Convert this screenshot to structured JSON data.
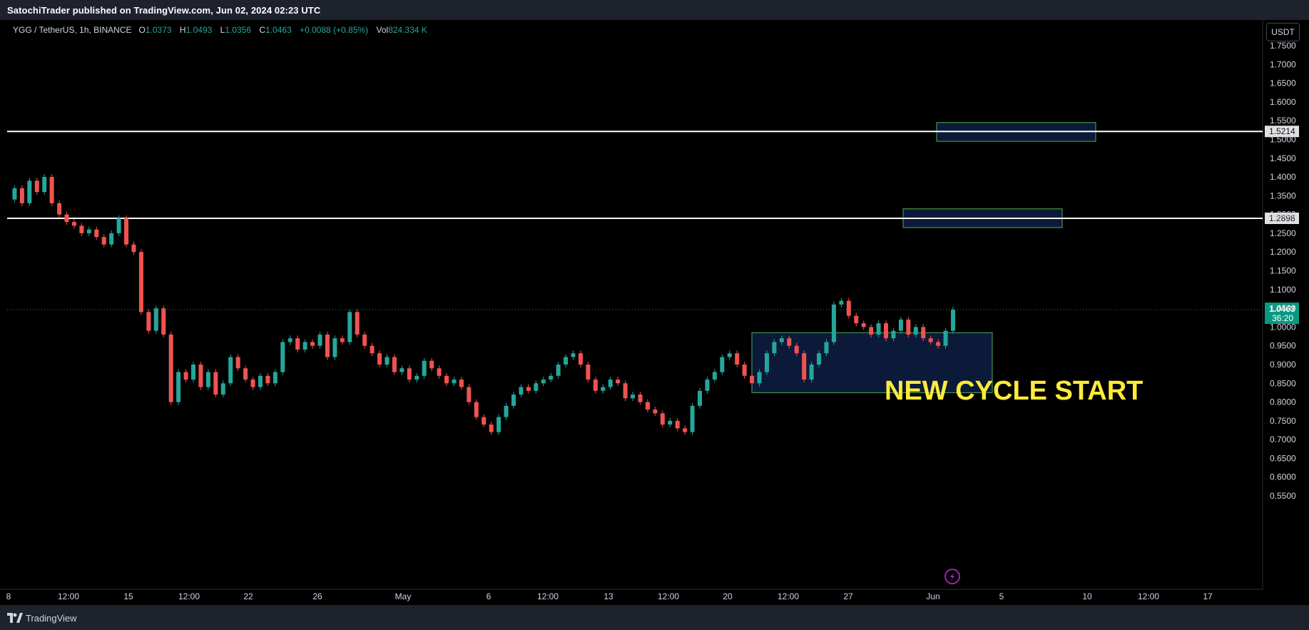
{
  "header": {
    "published": "SatochiTrader published on TradingView.com, Jun 02, 2024 02:23 UTC"
  },
  "footer": {
    "brand": "TradingView"
  },
  "legend": {
    "symbol": "YGG / TetherUS, 1h, BINANCE",
    "o_label": "O",
    "o_value": "1.0373",
    "h_label": "H",
    "h_value": "1.0493",
    "l_label": "L",
    "l_value": "1.0356",
    "c_label": "C",
    "c_value": "1.0463",
    "change": "+0.0088 (+0.85%)",
    "vol_label": "Vol",
    "vol_value": "824.334 K"
  },
  "currency_button": "USDT",
  "colors": {
    "up": "#26a69a",
    "down": "#ef5350",
    "zone_fill": "#0c1a3a",
    "zone_border": "#4caf50",
    "annotation": "#ffeb3b",
    "price_label": "#089981"
  },
  "chart_data": {
    "type": "line",
    "series": [
      {
        "values": [
          1.34,
          1.37,
          1.33,
          1.39,
          1.36,
          1.4,
          1.33,
          1.3,
          1.28,
          1.27,
          1.25,
          1.26,
          1.24,
          1.22,
          1.25,
          1.29,
          1.22,
          1.2,
          1.04,
          0.99,
          1.05,
          0.98,
          0.8,
          0.88,
          0.86,
          0.9,
          0.84,
          0.88,
          0.82,
          0.85,
          0.92,
          0.89,
          0.86,
          0.84,
          0.87,
          0.85,
          0.88,
          0.96,
          0.97,
          0.94,
          0.96,
          0.95,
          0.98,
          0.92,
          0.97,
          0.96,
          1.04,
          0.98,
          0.95,
          0.93,
          0.9,
          0.92,
          0.88,
          0.89,
          0.86,
          0.87,
          0.91,
          0.89,
          0.87,
          0.85,
          0.86,
          0.84,
          0.8,
          0.76,
          0.74,
          0.72,
          0.76,
          0.79,
          0.82,
          0.84,
          0.83,
          0.85,
          0.86,
          0.87,
          0.9,
          0.92,
          0.93,
          0.9,
          0.86,
          0.83,
          0.84,
          0.86,
          0.85,
          0.81,
          0.82,
          0.8,
          0.78,
          0.77,
          0.74,
          0.75,
          0.73,
          0.72,
          0.79,
          0.83,
          0.86,
          0.88,
          0.92,
          0.93,
          0.9,
          0.87,
          0.85,
          0.88,
          0.93,
          0.96,
          0.97,
          0.95,
          0.93,
          0.86,
          0.9,
          0.93,
          0.96,
          1.06,
          1.07,
          1.03,
          1.01,
          1.0,
          0.98,
          1.01,
          0.97,
          0.99,
          1.02,
          0.98,
          1.0,
          0.97,
          0.96,
          0.95,
          0.99,
          1.0463
        ]
      }
    ],
    "y_ticks": [
      "1.7500",
      "1.7000",
      "1.6500",
      "1.6000",
      "1.5500",
      "1.5000",
      "1.4500",
      "1.4000",
      "1.3500",
      "1.3000",
      "1.2500",
      "1.2000",
      "1.1500",
      "1.1000",
      "1.0500",
      "1.0000",
      "0.9500",
      "0.9000",
      "0.8500",
      "0.8000",
      "0.7500",
      "0.7000",
      "0.6500",
      "0.6000",
      "0.5500"
    ],
    "x_ticks": [
      "8",
      "12:00",
      "15",
      "12:00",
      "22",
      "26",
      "May",
      "6",
      "12:00",
      "13",
      "12:00",
      "20",
      "12:00",
      "27",
      "Jun",
      "5",
      "10",
      "12:00",
      "17"
    ],
    "ylim": [
      0.53,
      1.78
    ],
    "horizontal_lines": [
      {
        "price": 1.5214,
        "label": "1.5214"
      },
      {
        "price": 1.2898,
        "label": "1.2898"
      }
    ],
    "zones": [
      {
        "top": 1.545,
        "bottom": 1.495
      },
      {
        "top": 1.315,
        "bottom": 1.265
      },
      {
        "top": 0.985,
        "bottom": 0.825
      }
    ],
    "current_price": {
      "price": 1.0463,
      "label": "1.0463",
      "countdown": "36:20"
    },
    "annotation": "NEW CYCLE START"
  }
}
